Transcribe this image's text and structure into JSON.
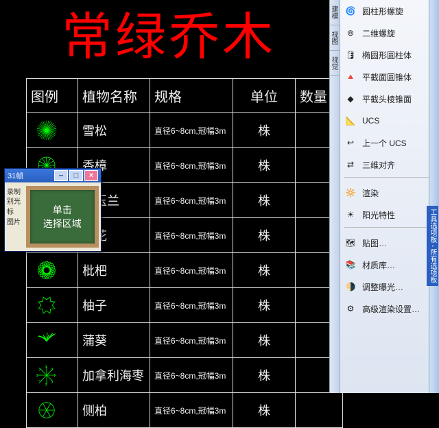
{
  "title": "常绿乔木",
  "table": {
    "headers": [
      "图例",
      "植物名称",
      "规格",
      "单位",
      "数量"
    ],
    "rows": [
      {
        "name": "雪松",
        "spec": "直径6~8cm,冠幅3m",
        "unit": "株"
      },
      {
        "name": "香樟",
        "spec": "直径6~8cm,冠幅3m",
        "unit": "株"
      },
      {
        "name": "广玉兰",
        "spec": "直径6~8cm,冠幅3m",
        "unit": "株"
      },
      {
        "name": "桂花",
        "spec": "直径6~8cm,冠幅3m",
        "unit": "株"
      },
      {
        "name": "枇杷",
        "spec": "直径6~8cm,冠幅3m",
        "unit": "株"
      },
      {
        "name": "柚子",
        "spec": "直径6~8cm,冠幅3m",
        "unit": "株"
      },
      {
        "name": "蒲葵",
        "spec": "直径6~8cm,冠幅3m",
        "unit": "株"
      },
      {
        "name": "加拿利海枣",
        "spec": "直径6~8cm,冠幅3m",
        "unit": "株"
      },
      {
        "name": "侧柏",
        "spec": "直径6~8cm,冠幅3m",
        "unit": "株"
      }
    ]
  },
  "popup": {
    "title": "31帧",
    "left": [
      "录制",
      "别光标",
      "图片"
    ],
    "board": [
      "单击",
      "选择区域"
    ]
  },
  "tools": {
    "vtabs": [
      "建模",
      "视图",
      "视觉"
    ],
    "items": [
      {
        "label": "圆柱形螺旋",
        "arr": true
      },
      {
        "label": "二维螺旋"
      },
      {
        "label": "椭圆形圆柱体"
      },
      {
        "label": "平截面圆锥体"
      },
      {
        "label": "平截头棱锥面"
      },
      {
        "label": "UCS",
        "arr": true
      },
      {
        "label": "上一个 UCS",
        "arr": true
      },
      {
        "label": "三维对齐",
        "arr": true
      },
      {
        "sep": true
      },
      {
        "label": "渲染",
        "arr": true
      },
      {
        "label": "阳光特性",
        "arr": true
      },
      {
        "sep": true
      },
      {
        "label": "贴图…",
        "arr": true
      },
      {
        "label": "材质库…"
      },
      {
        "label": "调整曝光…"
      },
      {
        "label": "高级渲染设置…"
      }
    ],
    "vlabel": "工具选项板 - 所有选项板"
  }
}
